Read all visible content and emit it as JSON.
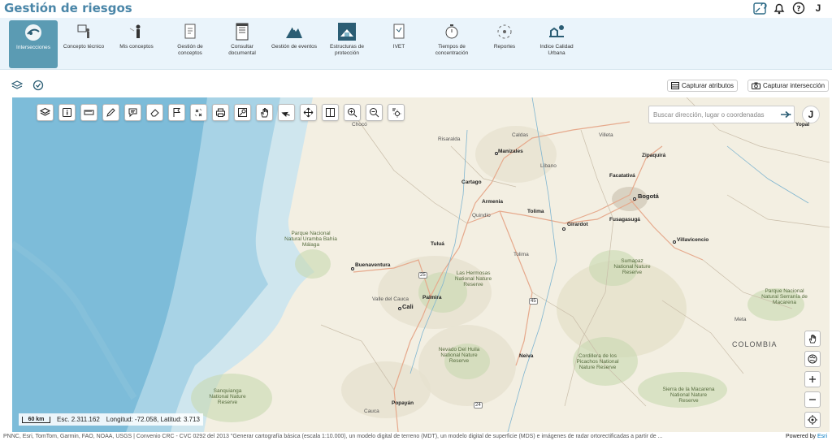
{
  "app": {
    "title": "Gestión de riesgos",
    "user_initial": "J"
  },
  "nav": {
    "items": [
      {
        "label": "Intersecciones",
        "active": true
      },
      {
        "label": "Concepto técnico"
      },
      {
        "label": "Mis conceptos"
      },
      {
        "label": "Gestión de conceptos"
      },
      {
        "label": "Consultar documental"
      },
      {
        "label": "Gestión de eventos"
      },
      {
        "label": "Estructuras de protección"
      },
      {
        "label": "IVET"
      },
      {
        "label": "Tiempos de concentración"
      },
      {
        "label": "Reportes"
      },
      {
        "label": "Indice Calidad Urbana"
      }
    ]
  },
  "toolbar": {
    "capture_attributes": "Capturar atributos",
    "capture_intersection": "Capturar intersección"
  },
  "map": {
    "search_placeholder": "Buscar dirección, lugar o coordenadas",
    "user_initial": "J",
    "scale_label": "60 km",
    "scale_text": "Esc. 2.311.162",
    "coords_text": "Longitud: -72.058, Latitud: 3.713",
    "labels": {
      "choco": "Chocó",
      "risaralda": "Risaralda",
      "caldas": "Caldas",
      "manizales": "Manizales",
      "libano": "Líbano",
      "villeta": "Villeta",
      "zipaquira": "Zipaquirá",
      "facatativa": "Facatativá",
      "bogota": "Bogotá",
      "cartago": "Cartago",
      "armenia": "Armenia",
      "quindio": "Quindío",
      "tolima_city": "Tolima",
      "girardot": "Girardot",
      "fusagasuga": "Fusagasugá",
      "villavicencio": "Villavicencio",
      "tulua": "Tuluá",
      "tolima_dept": "Tolima",
      "buenaventura": "Buenaventura",
      "palmira": "Palmira",
      "valle": "Valle del Cauca",
      "cali": "Cali",
      "neiva": "Neiva",
      "popayan": "Popayán",
      "cauca": "Cauca",
      "meta": "Meta",
      "colombia": "COLOMBIA",
      "yopal": "Yopal",
      "uramba": "Parque Nacional Natural Uramba Bahía Málaga",
      "hermosas": "Las Hermosas National Nature Reserve",
      "sumapaz": "Sumapaz National Nature Reserve",
      "macarena": "Parque Nacional Natural Serranía de Macarena",
      "huila": "Nevado Del Huila National Nature Reserve",
      "picachos": "Cordillera de los Picachos National Nature Reserve",
      "sanquianga": "Sanquianga National Nature Reserve",
      "sierra": "Sierra de la Macarena National Nature Reserve",
      "r25": "25",
      "r45": "45",
      "r24": "24"
    }
  },
  "attribution": "PNNC, Esri, TomTom, Garmin, FAO, NOAA, USGS | Convenio CRC - CVC 0292 del 2013 \"Generar cartografía básica (escala 1:10.000), un modelo digital de terreno (MDT), un modelo digital de superficie (MDS) e imágenes de radar ortorectificadas a partir de ...",
  "powered_by": "Powered by",
  "powered_by_brand": "Esri"
}
